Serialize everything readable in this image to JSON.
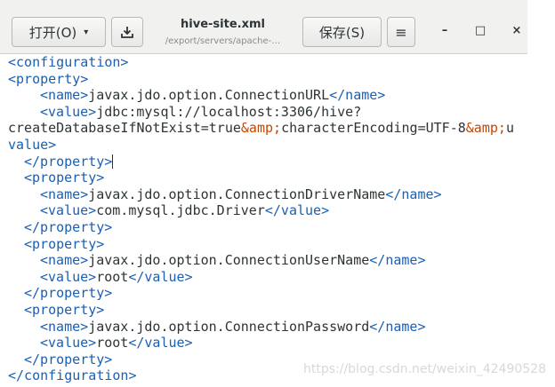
{
  "header": {
    "open_label": "打开(O)",
    "open_caret": "▾",
    "download_icon": "download-icon",
    "title": "hive-site.xml",
    "path": "/export/servers/apache-…",
    "save_label": "保存(S)",
    "menu_icon": "≡",
    "minimize": "–",
    "maximize": "□",
    "close": "×"
  },
  "editor": {
    "lines": [
      {
        "t": "<configuration>"
      },
      {
        "t": "<property>"
      },
      {
        "t1": "<name>",
        "v": "javax.jdo.option.ConnectionURL",
        "t2": "</name>"
      },
      {
        "t1": "<value>",
        "v": "jdbc:mysql://localhost:3306/hive?"
      },
      {
        "a": "createDatabaseIfNotExist=true",
        "e1": "&amp;",
        "b": "characterEncoding=UTF-8",
        "e2": "&amp;",
        "c": "u"
      },
      {
        "v": "value>"
      },
      {
        "t": "</property>"
      },
      {
        "t": "<property>"
      },
      {
        "t1": "<name>",
        "v": "javax.jdo.option.ConnectionDriverName",
        "t2": "</name>"
      },
      {
        "t1": "<value>",
        "v": "com.mysql.jdbc.Driver",
        "t2": "</value>"
      },
      {
        "t": "</property>"
      },
      {
        "t": "<property>"
      },
      {
        "t1": "<name>",
        "v": "javax.jdo.option.ConnectionUserName",
        "t2": "</name>"
      },
      {
        "t1": "<value>",
        "v": "root",
        "t2": "</value>"
      },
      {
        "t": "</property>"
      },
      {
        "t": "<property>"
      },
      {
        "t1": "<name>",
        "v": "javax.jdo.option.ConnectionPassword",
        "t2": "</name>"
      },
      {
        "t1": "<value>",
        "v": "root",
        "t2": "</value>"
      },
      {
        "t": "</property>"
      },
      {
        "t": "</configuration>"
      }
    ]
  },
  "watermark": "https://blog.csdn.net/weixin_42490528",
  "colors": {
    "tag": "#1a5fb4",
    "entity": "#c64600",
    "text": "#2e3436"
  }
}
